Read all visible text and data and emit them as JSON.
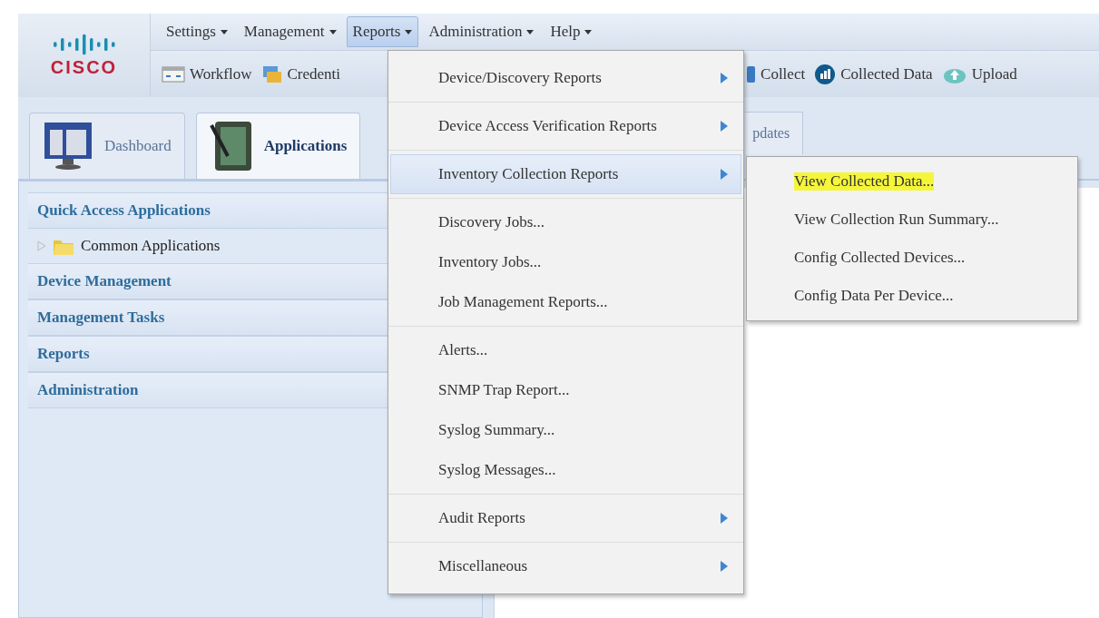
{
  "logo": {
    "text": "CISCO"
  },
  "menubar": [
    {
      "label": "Settings",
      "selected": false
    },
    {
      "label": "Management",
      "selected": false
    },
    {
      "label": "Reports",
      "selected": true
    },
    {
      "label": "Administration",
      "selected": false
    },
    {
      "label": "Help",
      "selected": false
    }
  ],
  "toolbar": {
    "left": [
      {
        "label": "Workflow",
        "kind": "workflow"
      },
      {
        "label": "Credenti",
        "kind": "credentials"
      }
    ],
    "right": [
      {
        "label": "Collect",
        "kind": "collect"
      },
      {
        "label": "Collected Data",
        "kind": "chart"
      },
      {
        "label": "Upload",
        "kind": "cloud"
      }
    ]
  },
  "tabs": [
    {
      "label": "Dashboard",
      "selected": false,
      "kind": "monitor"
    },
    {
      "label": "Applications",
      "selected": true,
      "kind": "notebook"
    }
  ],
  "partial_tab": {
    "label": "pdates"
  },
  "sidebar": [
    {
      "kind": "header",
      "label": "Quick Access Applications"
    },
    {
      "kind": "tree",
      "label": "Common Applications",
      "expanded": false
    },
    {
      "kind": "header",
      "label": "Device Management"
    },
    {
      "kind": "header",
      "label": "Management Tasks"
    },
    {
      "kind": "header",
      "label": "Reports"
    },
    {
      "kind": "header",
      "label": "Administration"
    }
  ],
  "reports_menu": [
    [
      {
        "label": "Device/Discovery Reports",
        "submenu": true,
        "selected": false
      }
    ],
    [
      {
        "label": "Device Access Verification Reports",
        "submenu": true,
        "selected": false
      }
    ],
    [
      {
        "label": "Inventory Collection Reports",
        "submenu": true,
        "selected": true
      }
    ],
    [
      {
        "label": "Discovery Jobs...",
        "submenu": false,
        "selected": false
      },
      {
        "label": "Inventory Jobs...",
        "submenu": false,
        "selected": false
      },
      {
        "label": "Job Management Reports...",
        "submenu": false,
        "selected": false
      }
    ],
    [
      {
        "label": "Alerts...",
        "submenu": false,
        "selected": false
      },
      {
        "label": "SNMP Trap Report...",
        "submenu": false,
        "selected": false
      },
      {
        "label": "Syslog Summary...",
        "submenu": false,
        "selected": false
      },
      {
        "label": "Syslog Messages...",
        "submenu": false,
        "selected": false
      }
    ],
    [
      {
        "label": "Audit Reports",
        "submenu": true,
        "selected": false
      }
    ],
    [
      {
        "label": "Miscellaneous",
        "submenu": true,
        "selected": false
      }
    ]
  ],
  "submenu": [
    {
      "label": "View Collected Data...",
      "highlighted": true
    },
    {
      "label": "View Collection Run Summary...",
      "highlighted": false
    },
    {
      "label": "Config Collected Devices...",
      "highlighted": false
    },
    {
      "label": "Config Data Per Device...",
      "highlighted": false
    }
  ]
}
